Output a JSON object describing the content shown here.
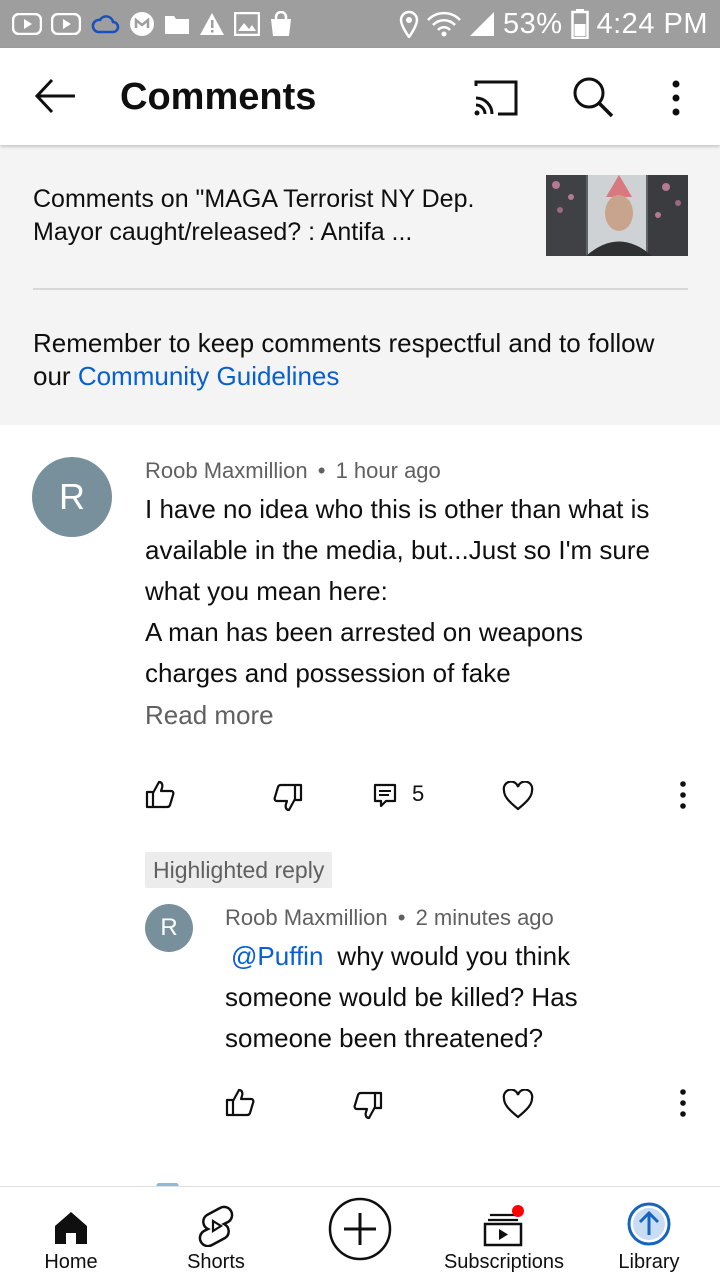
{
  "status_bar": {
    "battery": "53%",
    "time": "4:24 PM",
    "icons": [
      "youtube-icon",
      "youtube-icon",
      "cloud-icon",
      "app-icon",
      "folder-icon",
      "warning-icon",
      "image-icon",
      "shopping-bag-icon",
      "location-icon",
      "wifi-icon",
      "signal-icon",
      "battery-icon"
    ]
  },
  "app_bar": {
    "title": "Comments",
    "icons": [
      "back-arrow-icon",
      "cast-icon",
      "search-icon",
      "more-vert-icon"
    ]
  },
  "header": {
    "video_title": "Comments on \"MAGA Terrorist NY Dep. Mayor caught/released? : Antifa ...",
    "reminder_text": "Remember to keep comments respectful and to follow our ",
    "reminder_link": "Community Guidelines"
  },
  "comments": [
    {
      "avatar_letter": "R",
      "author": "Roob Maxmillion",
      "time": "1 hour ago",
      "lines": [
        "I have no idea who this is other than what is",
        "available in the media, but...Just so I'm sure",
        "what you mean here:",
        "A man has been arrested on weapons",
        "charges and possession of fake"
      ],
      "read_more": "Read more",
      "reply_count": "5"
    }
  ],
  "highlighted_label": "Highlighted reply",
  "reply": {
    "avatar_letter": "R",
    "author": "Roob Maxmillion",
    "time": "2 minutes ago",
    "mention": "@Puffin",
    "line1": "why would you think",
    "line2": "someone would be killed? Has",
    "line3": "someone been threatened?"
  },
  "separator": "•",
  "bottom_nav": {
    "items": [
      {
        "label": "Home",
        "icon": "home-icon"
      },
      {
        "label": "Shorts",
        "icon": "shorts-icon"
      },
      {
        "label": "",
        "icon": "create-plus-icon"
      },
      {
        "label": "Subscriptions",
        "icon": "subscriptions-icon"
      },
      {
        "label": "Library",
        "icon": "library-icon"
      }
    ]
  },
  "colors": {
    "status_bar": "#9e9e9e",
    "link": "#065fd4",
    "avatar": "#78909c",
    "notification_dot": "#ff0000"
  }
}
